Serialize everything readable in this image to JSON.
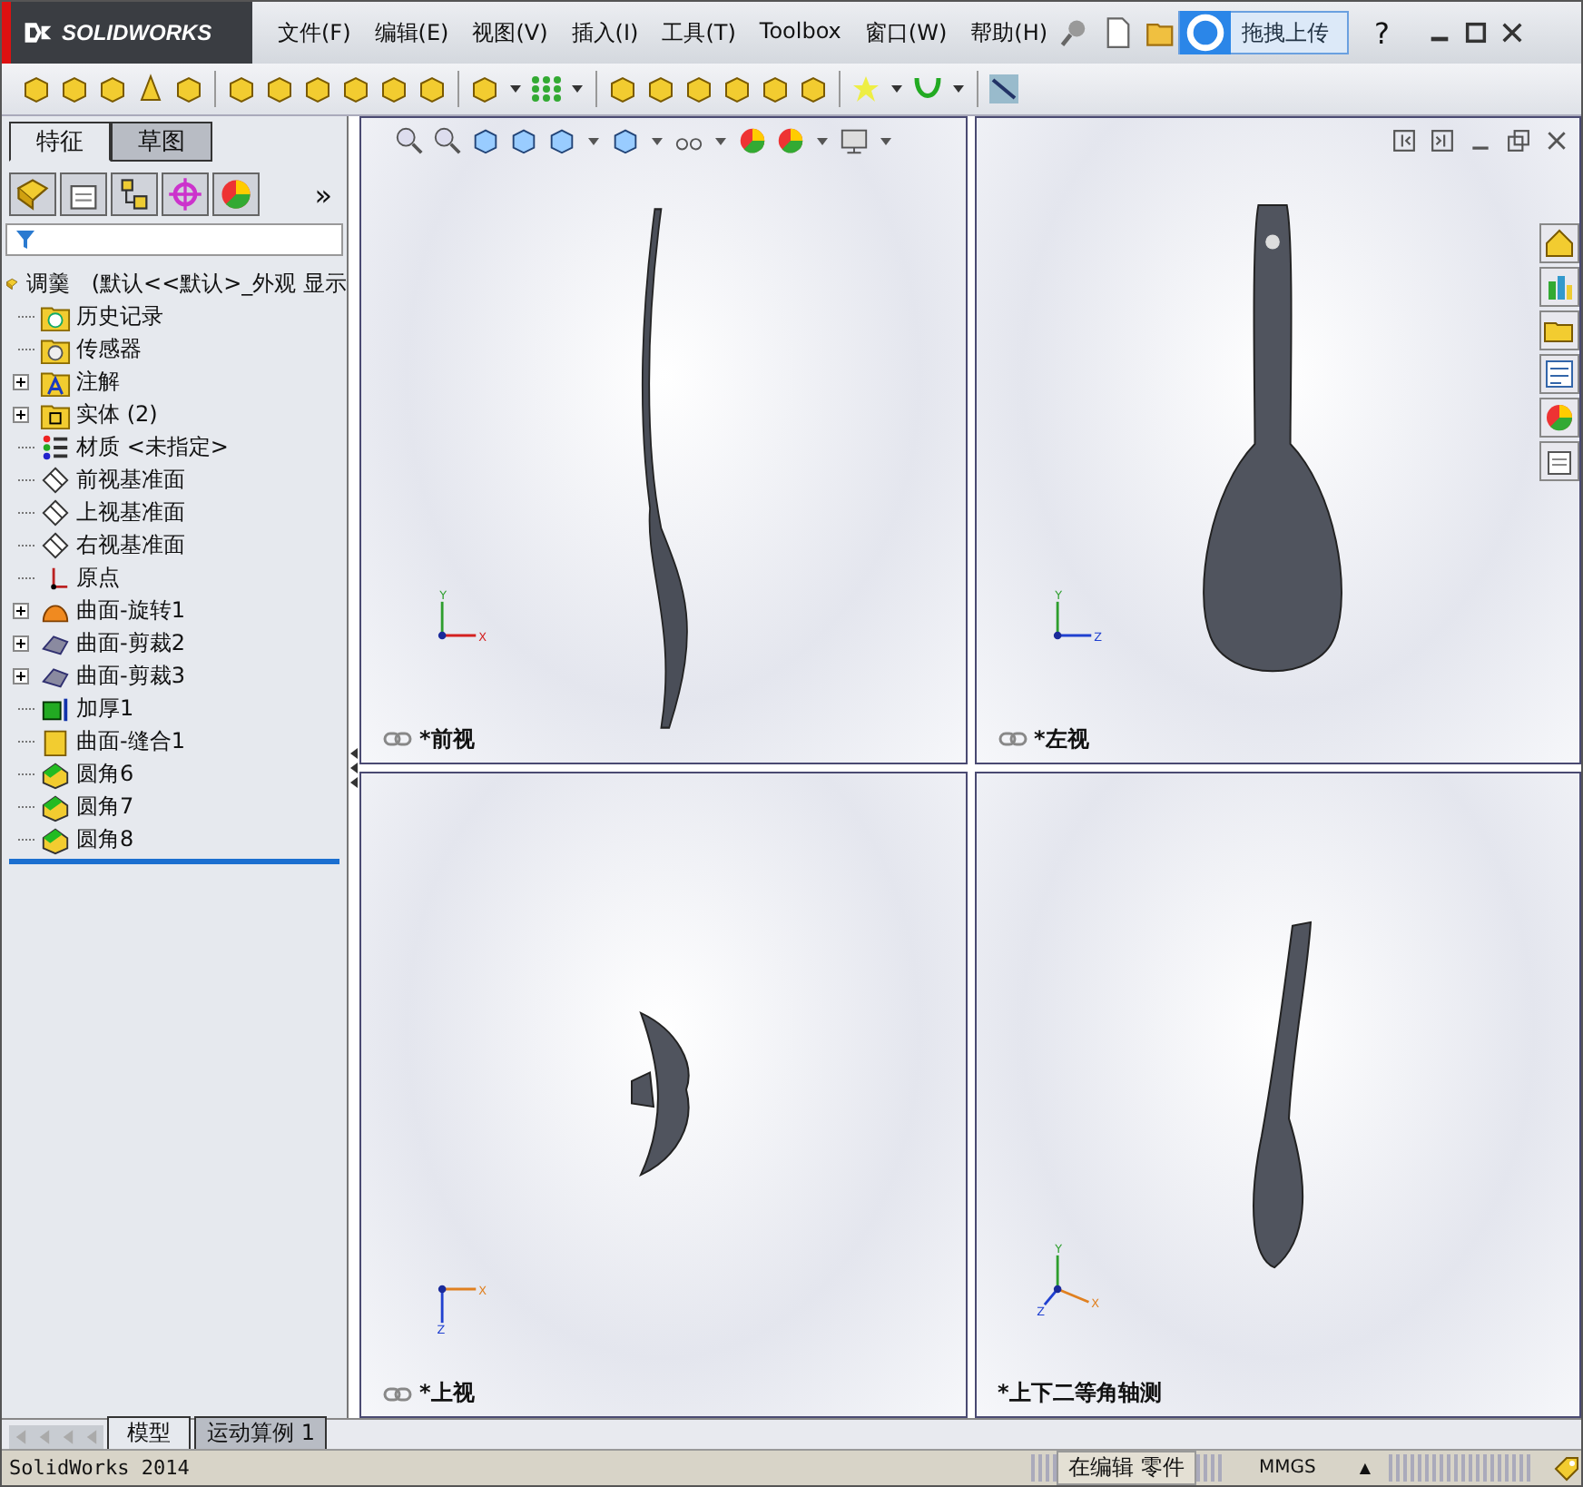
{
  "window": {
    "logo": "SOLIDWORKS",
    "menu": [
      "文件(F)",
      "编辑(E)",
      "视图(V)",
      "插入(I)",
      "工具(T)",
      "Toolbox",
      "窗口(W)",
      "帮助(H)"
    ],
    "upload_button": "拖拽上传",
    "help": "?"
  },
  "panel": {
    "tabs": [
      {
        "label": "特征",
        "selected": true
      },
      {
        "label": "草图",
        "selected": false
      }
    ],
    "more": "»",
    "tree": {
      "root": "调羹",
      "config": "(默认<<默认>_外观 显示",
      "items": [
        {
          "label": "历史记录",
          "kind": "history",
          "expandable": false
        },
        {
          "label": "传感器",
          "kind": "sensor",
          "expandable": false
        },
        {
          "label": "注解",
          "kind": "annotation",
          "expandable": true
        },
        {
          "label": "实体 (2)",
          "kind": "body",
          "expandable": true
        },
        {
          "label": "材质 <未指定>",
          "kind": "material",
          "expandable": false
        },
        {
          "label": "前视基准面",
          "kind": "plane",
          "expandable": false
        },
        {
          "label": "上视基准面",
          "kind": "plane",
          "expandable": false
        },
        {
          "label": "右视基准面",
          "kind": "plane",
          "expandable": false
        },
        {
          "label": "原点",
          "kind": "origin",
          "expandable": false
        },
        {
          "label": "曲面-旋转1",
          "kind": "revolve",
          "expandable": true
        },
        {
          "label": "曲面-剪裁2",
          "kind": "trim",
          "expandable": true
        },
        {
          "label": "曲面-剪裁3",
          "kind": "trim",
          "expandable": true
        },
        {
          "label": "加厚1",
          "kind": "thicken",
          "expandable": false
        },
        {
          "label": "曲面-缝合1",
          "kind": "knit",
          "expandable": false
        },
        {
          "label": "圆角6",
          "kind": "fillet",
          "expandable": false
        },
        {
          "label": "圆角7",
          "kind": "fillet",
          "expandable": false
        },
        {
          "label": "圆角8",
          "kind": "fillet",
          "expandable": false
        }
      ]
    }
  },
  "viewports": [
    {
      "label": "*前视",
      "kind": "front",
      "linked": true,
      "axes": [
        {
          "label": "Y",
          "kind": "up",
          "color": "#2e9e2e"
        },
        {
          "label": "X",
          "kind": "right",
          "color": "#d42020"
        }
      ]
    },
    {
      "label": "*左视",
      "kind": "left",
      "linked": true,
      "axes": [
        {
          "label": "Y",
          "kind": "up",
          "color": "#2e9e2e"
        },
        {
          "label": "Z",
          "kind": "right",
          "color": "#2040d0"
        }
      ]
    },
    {
      "label": "*上视",
      "kind": "top",
      "linked": true,
      "axes": [
        {
          "label": "X",
          "kind": "right",
          "color": "#e08020"
        },
        {
          "label": "Z",
          "kind": "down",
          "color": "#2040d0"
        }
      ]
    },
    {
      "label": "*上下二等角轴测",
      "kind": "iso",
      "linked": false,
      "axes": [
        {
          "label": "Y",
          "kind": "up",
          "color": "#2e9e2e"
        },
        {
          "label": "X",
          "kind": "diagright",
          "color": "#e08020"
        },
        {
          "label": "Z",
          "kind": "diagleft",
          "color": "#2040d0"
        }
      ]
    }
  ],
  "bottom_tabs": [
    {
      "label": "模型",
      "selected": true
    },
    {
      "label": "运动算例 1",
      "selected": false
    }
  ],
  "status_bar": {
    "app": "SolidWorks 2014",
    "mode": "在编辑 零件",
    "units": "MMGS",
    "units_arrow": "▲"
  }
}
